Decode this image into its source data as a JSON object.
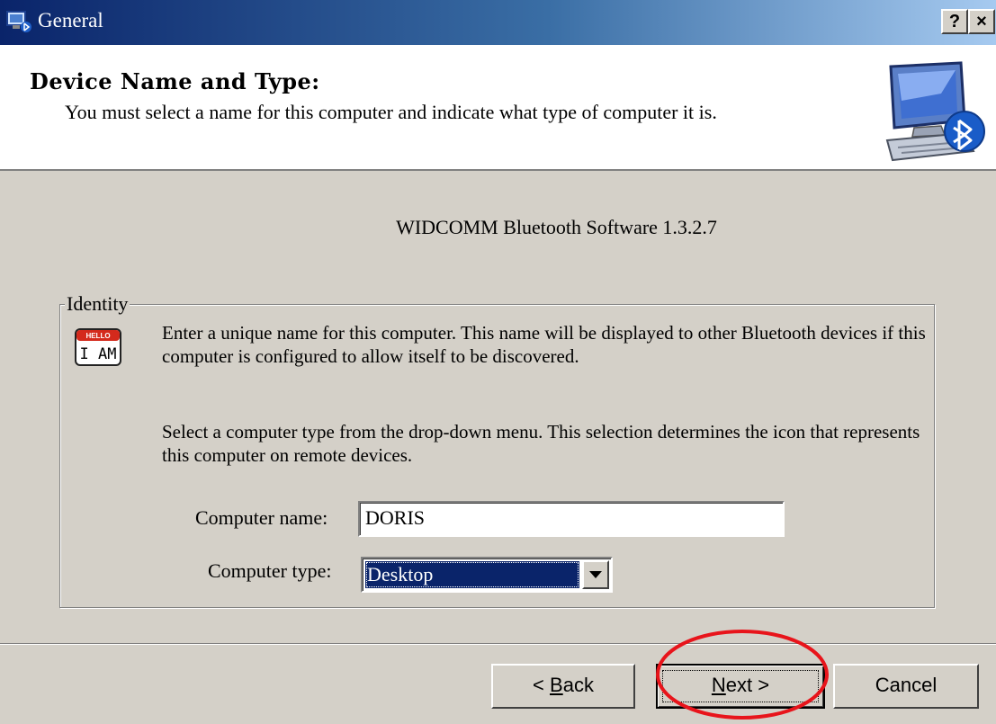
{
  "window": {
    "title": "General",
    "help_button": "?",
    "close_button": "×"
  },
  "header": {
    "title": "Device Name and Type:",
    "subtitle": "You must select a name for this computer and indicate what type of computer it is."
  },
  "version_text": "WIDCOMM Bluetooth Software 1.3.2.7",
  "identity": {
    "legend": "Identity",
    "icon_top_text": "HELLO",
    "icon_text": "I AM",
    "paragraph1": "Enter a unique name for this computer.  This name will be displayed to other Bluetooth devices if this computer is configured to allow itself to be discovered.",
    "paragraph2": "Select a computer type from the drop-down menu.  This selection determines the icon that represents this computer on remote devices.",
    "computer_name_label": "Computer name:",
    "computer_name_value": "DORIS",
    "computer_type_label": "Computer type:",
    "computer_type_value": "Desktop"
  },
  "buttons": {
    "back_prefix": "< ",
    "back_accel": "B",
    "back_rest": "ack",
    "next_accel": "N",
    "next_rest": "ext >",
    "cancel": "Cancel"
  },
  "colors": {
    "dialog_bg": "#d4d0c8",
    "titlebar_start": "#0a246a",
    "titlebar_end": "#a6caf0",
    "selection": "#0a246a",
    "annotation_circle": "#e8141b"
  },
  "icons": [
    "bluetooth-window-icon",
    "computer-bluetooth-icon",
    "hello-i-am-icon",
    "dropdown-arrow-icon"
  ]
}
